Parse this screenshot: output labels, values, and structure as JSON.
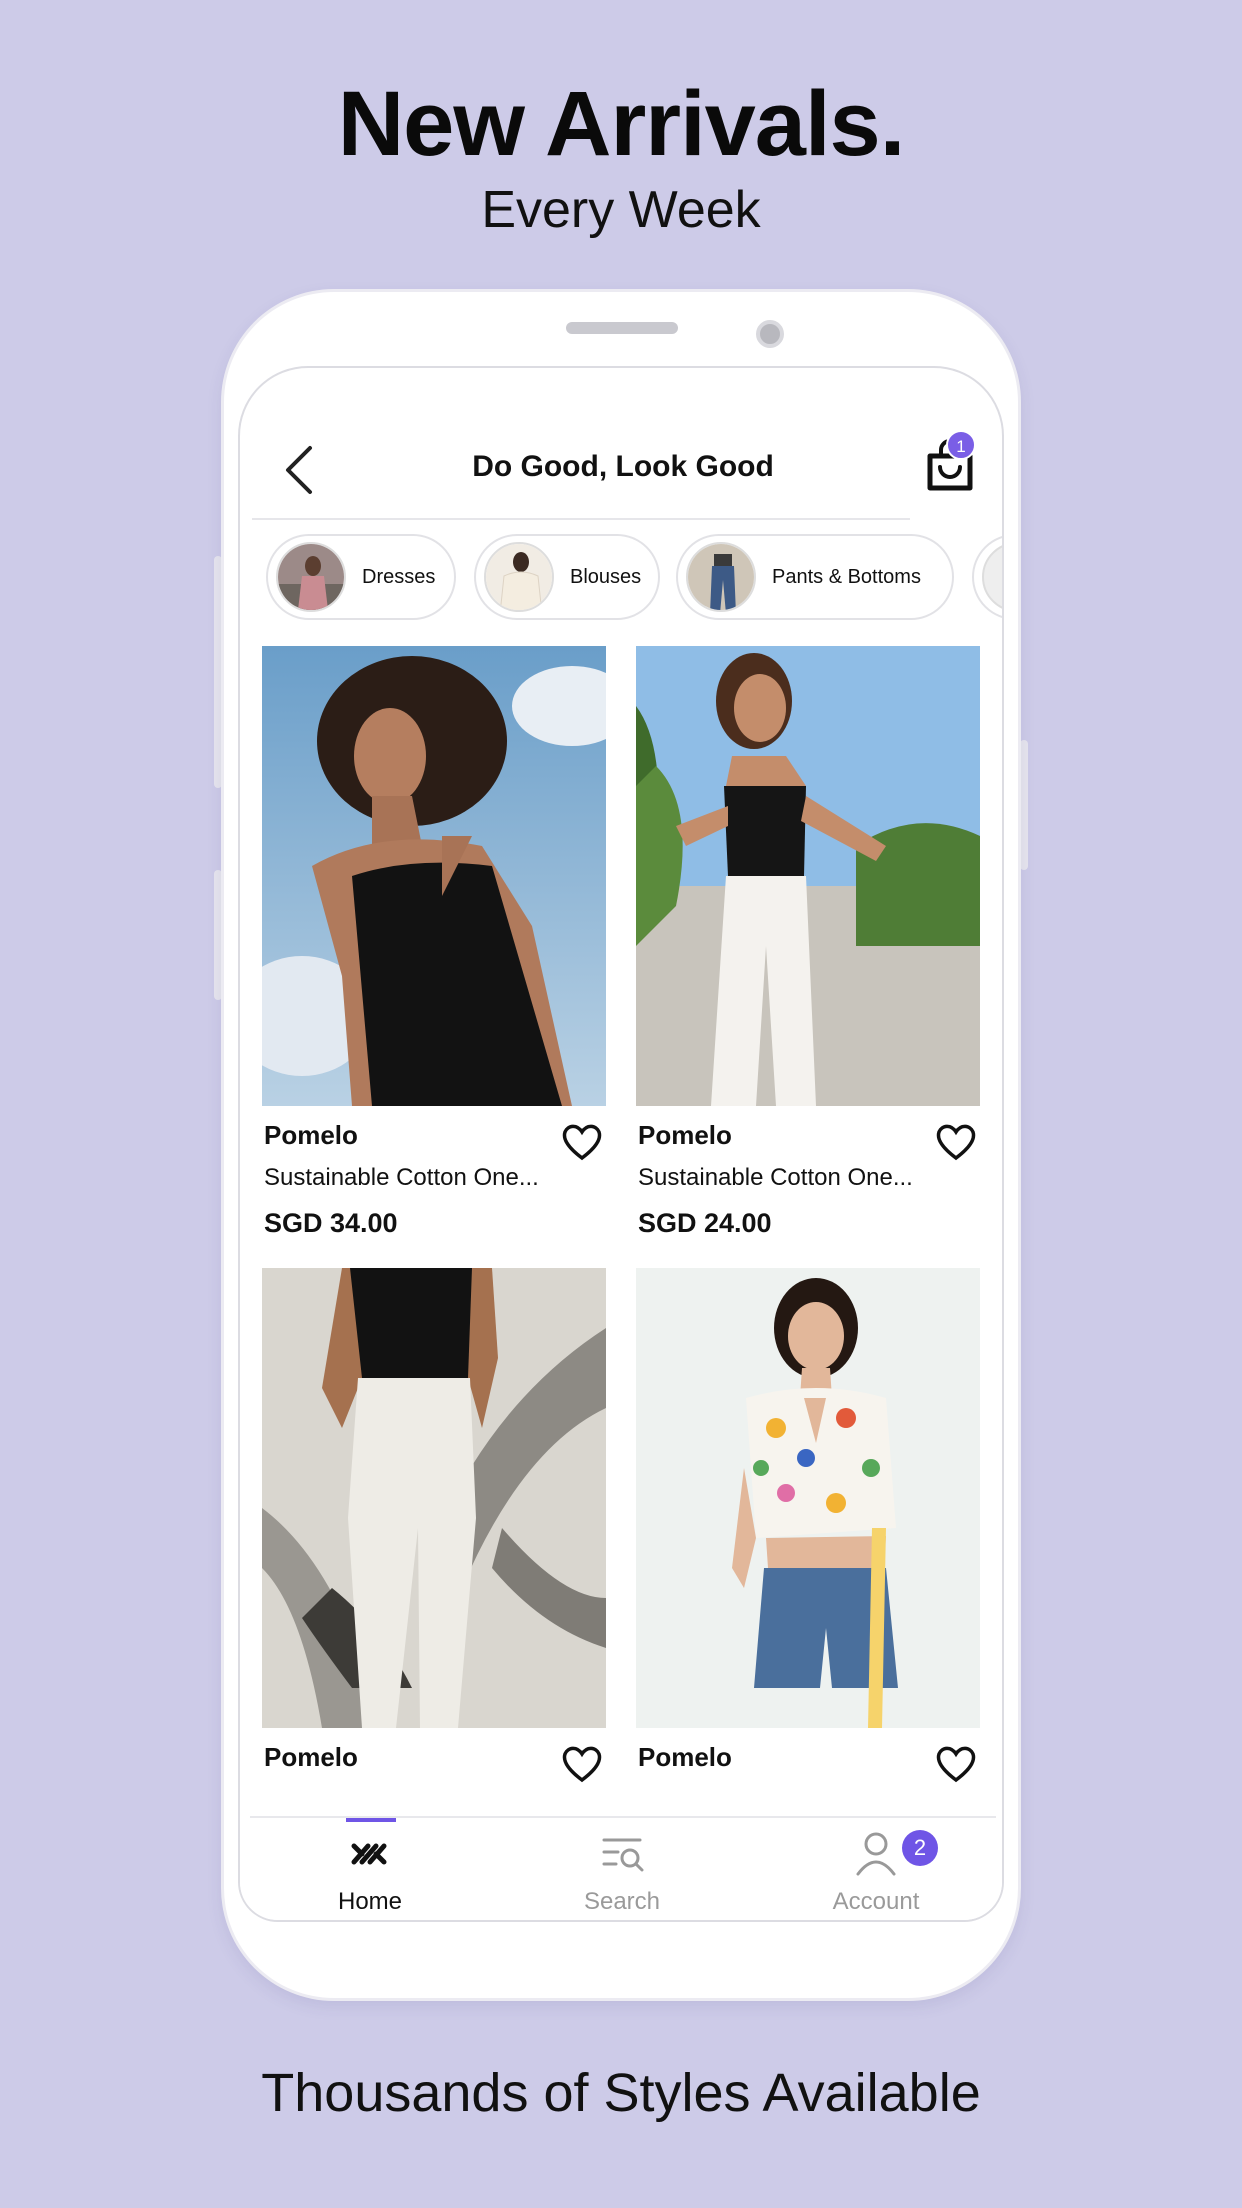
{
  "promo": {
    "headline": "New Arrivals.",
    "subheadline": "Every Week",
    "footer": "Thousands of Styles Available"
  },
  "header": {
    "title": "Do Good, Look Good",
    "cart_count": "1"
  },
  "categories": [
    {
      "label": "Dresses"
    },
    {
      "label": "Blouses"
    },
    {
      "label": "Pants & Bottoms"
    }
  ],
  "products": [
    {
      "brand": "Pomelo",
      "name": "Sustainable Cotton One...",
      "price": "SGD 34.00"
    },
    {
      "brand": "Pomelo",
      "name": "Sustainable Cotton One...",
      "price": "SGD 24.00"
    },
    {
      "brand": "Pomelo"
    },
    {
      "brand": "Pomelo"
    }
  ],
  "nav": {
    "items": [
      {
        "label": "Home",
        "icon": "home-logo-icon",
        "active": true
      },
      {
        "label": "Search",
        "icon": "search-icon"
      },
      {
        "label": "Account",
        "icon": "account-icon",
        "badge": "2"
      }
    ]
  },
  "colors": {
    "background": "#cdcbe8",
    "accent": "#6f55e6",
    "badge": "#7a5ee6"
  }
}
